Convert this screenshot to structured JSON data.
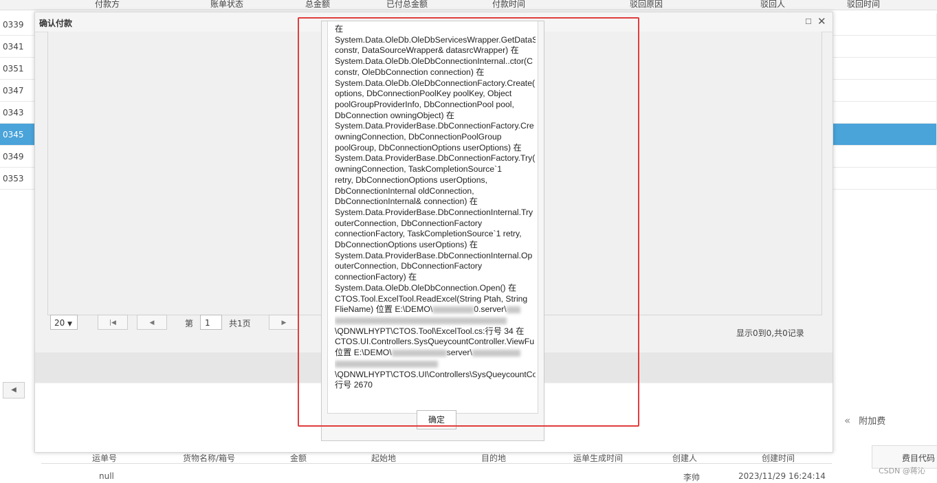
{
  "background_table": {
    "headers": [
      "付款方",
      "账单状态",
      "总金额",
      "已付总金额",
      "付款时间",
      "驳回原因",
      "驳回人",
      "驳回时间"
    ],
    "row_ids": [
      "0339",
      "0341",
      "0351",
      "0347",
      "0343",
      "0345",
      "0349",
      "0353"
    ],
    "selected_row_index": 5
  },
  "bottom_table": {
    "headers": [
      "运单号",
      "货物名称/箱号",
      "金额",
      "起始地",
      "目的地",
      "运单生成时间",
      "创建人",
      "创建时间"
    ],
    "fee_header": "费目代码",
    "attach_label": "附加费",
    "row": {
      "waybill": "null",
      "creator": "李帅",
      "created_at": "2023/11/29 16:24:14"
    }
  },
  "dialog": {
    "title": "确认付款",
    "pager": {
      "page_size": "20",
      "page_prefix": "第",
      "page_value": "1",
      "page_suffix": "共1页",
      "info": "显示0到0,共0记录"
    }
  },
  "message_box": {
    "lines": [
      "在",
      "System.Data.OleDb.OleDbServicesWrapper.GetDataS",
      "constr, DataSourceWrapper& datasrcWrapper) 在",
      "System.Data.OleDb.OleDbConnectionInternal..ctor(C",
      "constr, OleDbConnection connection) 在",
      "System.Data.OleDb.OleDbConnectionFactory.Create(",
      "options, DbConnectionPoolKey poolKey, Object",
      "poolGroupProviderInfo, DbConnectionPool pool,",
      "DbConnection owningObject) 在",
      "System.Data.ProviderBase.DbConnectionFactory.Cre",
      "owningConnection, DbConnectionPoolGroup",
      "poolGroup, DbConnectionOptions userOptions) 在",
      "System.Data.ProviderBase.DbConnectionFactory.Try(",
      "owningConnection, TaskCompletionSource`1",
      "retry, DbConnectionOptions userOptions,",
      "DbConnectionInternal oldConnection,",
      "DbConnectionInternal& connection) 在",
      "System.Data.ProviderBase.DbConnectionInternal.Try",
      "outerConnection, DbConnectionFactory",
      "connectionFactory, TaskCompletionSource`1 retry,",
      "DbConnectionOptions userOptions) 在",
      "System.Data.ProviderBase.DbConnectionInternal.Op",
      "outerConnection, DbConnectionFactory",
      "connectionFactory) 在",
      "System.Data.OleDb.OleDbConnection.Open() 在",
      "CTOS.Tool.ExcelTool.ReadExcel(String Ptah, String",
      "FlieName) 位置 E:\\DEMO\\",
      "",
      "\\QDNWLHYPT\\CTOS.Tool\\ExcelTool.cs:行号 34 在",
      "CTOS.UI.Controllers.SysQueycountController.ViewFu",
      "位置 E:\\DEMO\\",
      "",
      "\\QDNWLHYPT\\CTOS.UI\\Controllers\\SysQueycountCo",
      "行号 2670"
    ],
    "line27_tail": "0.server\\",
    "line31_tail": "server\\",
    "ok_label": "确定"
  },
  "watermark": "CSDN @蒋沁"
}
